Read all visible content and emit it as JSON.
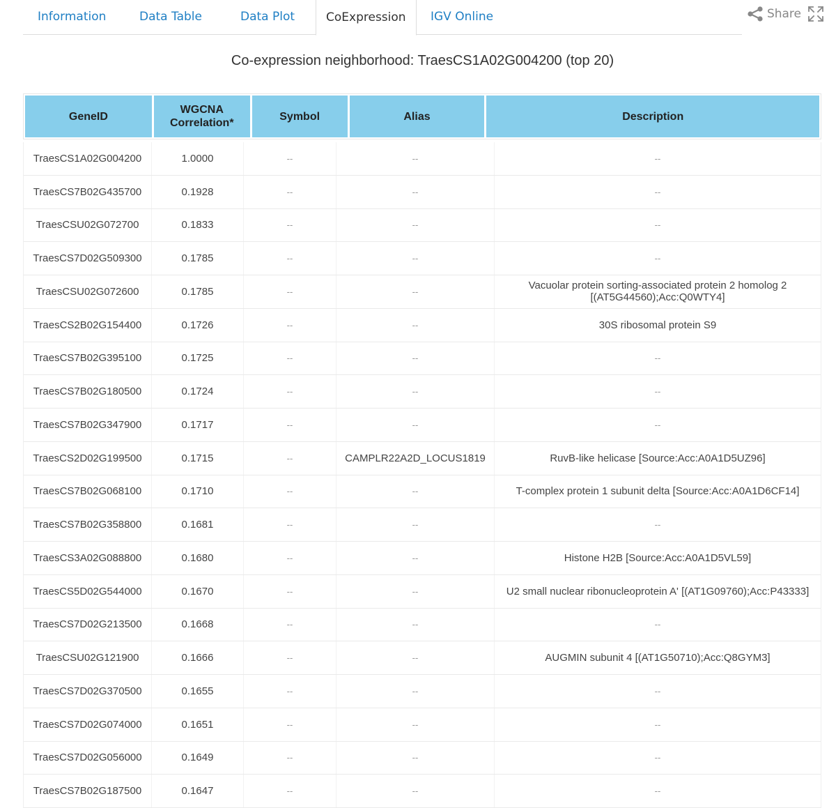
{
  "tabs": [
    {
      "label": "Information",
      "active": false
    },
    {
      "label": "Data Table",
      "active": false
    },
    {
      "label": "Data Plot",
      "active": false
    },
    {
      "label": "CoExpression",
      "active": true
    },
    {
      "label": "IGV Online",
      "active": false
    }
  ],
  "toolbar": {
    "share_label": "Share",
    "share_icon": "share-icon",
    "expand_icon": "fullscreen-icon"
  },
  "title": "Co-expression neighborhood: TraesCS1A02G004200 (top 20)",
  "table": {
    "headers": {
      "gene_id": "GeneID",
      "correlation_line1": "WGCNA",
      "correlation_line2": "Correlation*",
      "symbol": "Symbol",
      "alias": "Alias",
      "description": "Description"
    },
    "rows": [
      {
        "gene_id": "TraesCS1A02G004200",
        "correlation": "1.0000",
        "symbol": "--",
        "alias": "--",
        "description": "--"
      },
      {
        "gene_id": "TraesCS7B02G435700",
        "correlation": "0.1928",
        "symbol": "--",
        "alias": "--",
        "description": "--"
      },
      {
        "gene_id": "TraesCSU02G072700",
        "correlation": "0.1833",
        "symbol": "--",
        "alias": "--",
        "description": "--"
      },
      {
        "gene_id": "TraesCS7D02G509300",
        "correlation": "0.1785",
        "symbol": "--",
        "alias": "--",
        "description": "--"
      },
      {
        "gene_id": "TraesCSU02G072600",
        "correlation": "0.1785",
        "symbol": "--",
        "alias": "--",
        "description": "Vacuolar protein sorting-associated protein 2 homolog 2 [(AT5G44560);Acc:Q0WTY4]"
      },
      {
        "gene_id": "TraesCS2B02G154400",
        "correlation": "0.1726",
        "symbol": "--",
        "alias": "--",
        "description": "30S ribosomal protein S9"
      },
      {
        "gene_id": "TraesCS7B02G395100",
        "correlation": "0.1725",
        "symbol": "--",
        "alias": "--",
        "description": "--"
      },
      {
        "gene_id": "TraesCS7B02G180500",
        "correlation": "0.1724",
        "symbol": "--",
        "alias": "--",
        "description": "--"
      },
      {
        "gene_id": "TraesCS7B02G347900",
        "correlation": "0.1717",
        "symbol": "--",
        "alias": "--",
        "description": "--"
      },
      {
        "gene_id": "TraesCS2D02G199500",
        "correlation": "0.1715",
        "symbol": "--",
        "alias": "CAMPLR22A2D_LOCUS1819",
        "description": "RuvB-like helicase [Source:Acc:A0A1D5UZ96]"
      },
      {
        "gene_id": "TraesCS7B02G068100",
        "correlation": "0.1710",
        "symbol": "--",
        "alias": "--",
        "description": "T-complex protein 1 subunit delta [Source:Acc:A0A1D6CF14]"
      },
      {
        "gene_id": "TraesCS7B02G358800",
        "correlation": "0.1681",
        "symbol": "--",
        "alias": "--",
        "description": "--"
      },
      {
        "gene_id": "TraesCS3A02G088800",
        "correlation": "0.1680",
        "symbol": "--",
        "alias": "--",
        "description": "Histone H2B [Source:Acc:A0A1D5VL59]"
      },
      {
        "gene_id": "TraesCS5D02G544000",
        "correlation": "0.1670",
        "symbol": "--",
        "alias": "--",
        "description": "U2 small nuclear ribonucleoprotein A' [(AT1G09760);Acc:P43333]"
      },
      {
        "gene_id": "TraesCS7D02G213500",
        "correlation": "0.1668",
        "symbol": "--",
        "alias": "--",
        "description": "--"
      },
      {
        "gene_id": "TraesCSU02G121900",
        "correlation": "0.1666",
        "symbol": "--",
        "alias": "--",
        "description": "AUGMIN subunit 4 [(AT1G50710);Acc:Q8GYM3]"
      },
      {
        "gene_id": "TraesCS7D02G370500",
        "correlation": "0.1655",
        "symbol": "--",
        "alias": "--",
        "description": "--"
      },
      {
        "gene_id": "TraesCS7D02G074000",
        "correlation": "0.1651",
        "symbol": "--",
        "alias": "--",
        "description": "--"
      },
      {
        "gene_id": "TraesCS7D02G056000",
        "correlation": "0.1649",
        "symbol": "--",
        "alias": "--",
        "description": "--"
      },
      {
        "gene_id": "TraesCS7B02G187500",
        "correlation": "0.1647",
        "symbol": "--",
        "alias": "--",
        "description": "--"
      }
    ]
  }
}
